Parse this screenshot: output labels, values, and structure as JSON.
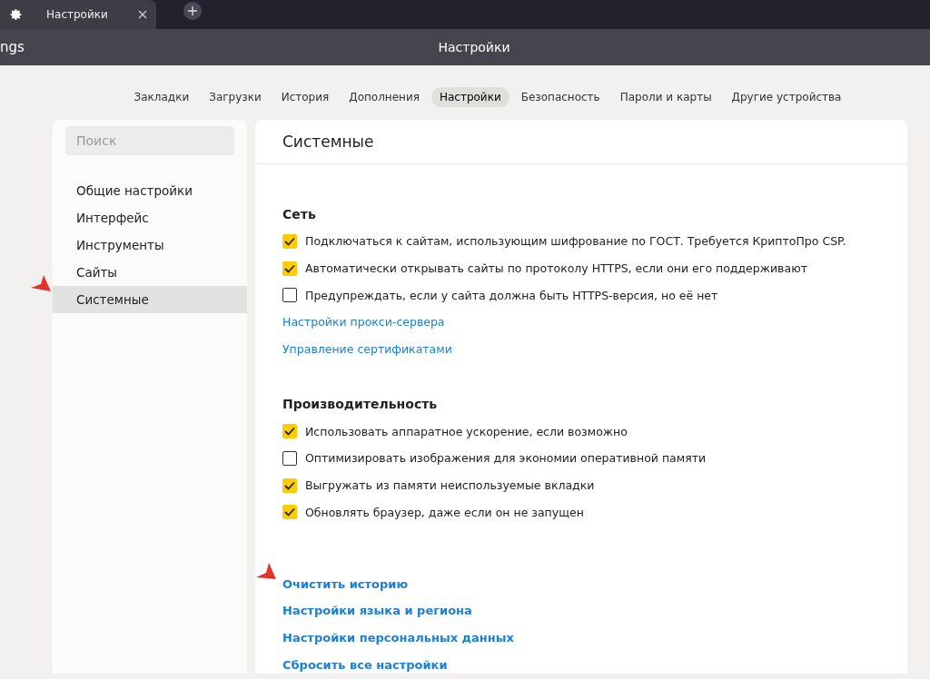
{
  "browser_tabs": [
    {
      "title": "Настройки",
      "selected": true
    }
  ],
  "title_bar": {
    "left_text": "ngs",
    "title": "Настройки"
  },
  "nav_tabs": [
    {
      "label": "Закладки",
      "selected": false
    },
    {
      "label": "Загрузки",
      "selected": false
    },
    {
      "label": "История",
      "selected": false
    },
    {
      "label": "Дополнения",
      "selected": false
    },
    {
      "label": "Настройки",
      "selected": true
    },
    {
      "label": "Безопасность",
      "selected": false
    },
    {
      "label": "Пароли и карты",
      "selected": false
    },
    {
      "label": "Другие устройства",
      "selected": false
    }
  ],
  "sidebar": {
    "search": {
      "placeholder": "Поиск"
    },
    "items": [
      {
        "label": "Общие настройки",
        "selected": false
      },
      {
        "label": "Интерфейс",
        "selected": false
      },
      {
        "label": "Инструменты",
        "selected": false
      },
      {
        "label": "Сайты",
        "selected": false
      },
      {
        "label": "Системные",
        "selected": true
      }
    ]
  },
  "panel": {
    "title": "Системные",
    "sections": [
      {
        "heading": "Сеть",
        "options": [
          {
            "label": "Подключаться к сайтам, использующим шифрование по ГОСТ. Требуется КриптоПро CSP.",
            "checked": true
          },
          {
            "label": "Автоматически открывать сайты по протоколу HTTPS, если они его поддерживают",
            "checked": true
          },
          {
            "label": "Предупреждать, если у сайта должна быть HTTPS-версия, но её нет",
            "checked": false
          }
        ],
        "links": [
          "Настройки прокси-сервера",
          "Управление сертификатами"
        ]
      },
      {
        "heading": "Производительность",
        "options": [
          {
            "label": "Использовать аппаратное ускорение, если возможно",
            "checked": true
          },
          {
            "label": "Оптимизировать изображения для экономии оперативной памяти",
            "checked": false
          },
          {
            "label": "Выгружать из памяти неиспользуемые вкладки",
            "checked": true
          },
          {
            "label": "Обновлять браузер, даже если он не запущен",
            "checked": true
          }
        ]
      }
    ],
    "actions": [
      "Очистить историю",
      "Настройки языка и региона",
      "Настройки персональных данных",
      "Сбросить все настройки"
    ]
  }
}
